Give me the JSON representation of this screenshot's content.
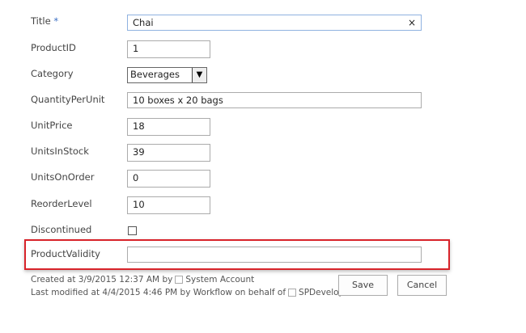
{
  "fields": {
    "title": {
      "label": "Title",
      "required_mark": "*",
      "value": "Chai",
      "clear_icon": "×"
    },
    "product_id": {
      "label": "ProductID",
      "value": "1"
    },
    "category": {
      "label": "Category",
      "value": "Beverages",
      "arrow": "▼"
    },
    "quantity_per_unit": {
      "label": "QuantityPerUnit",
      "value": "10 boxes x 20 bags"
    },
    "unit_price": {
      "label": "UnitPrice",
      "value": "18"
    },
    "units_in_stock": {
      "label": "UnitsInStock",
      "value": "39"
    },
    "units_on_order": {
      "label": "UnitsOnOrder",
      "value": "0"
    },
    "reorder_level": {
      "label": "ReorderLevel",
      "value": "10"
    },
    "discontinued": {
      "label": "Discontinued",
      "checked": false
    },
    "product_validity": {
      "label": "ProductValidity",
      "value": ""
    }
  },
  "footer": {
    "created_prefix": "Created at 3/9/2015 12:37 AM  by",
    "created_by": "System Account",
    "modified_prefix": "Last modified at 4/4/2015 4:46 PM  by Workflow on behalf of",
    "modified_by": "SPDeveloper"
  },
  "buttons": {
    "save": "Save",
    "cancel": "Cancel"
  },
  "colors": {
    "highlight": "#d8232a",
    "focus_border": "#8fb2e0"
  }
}
